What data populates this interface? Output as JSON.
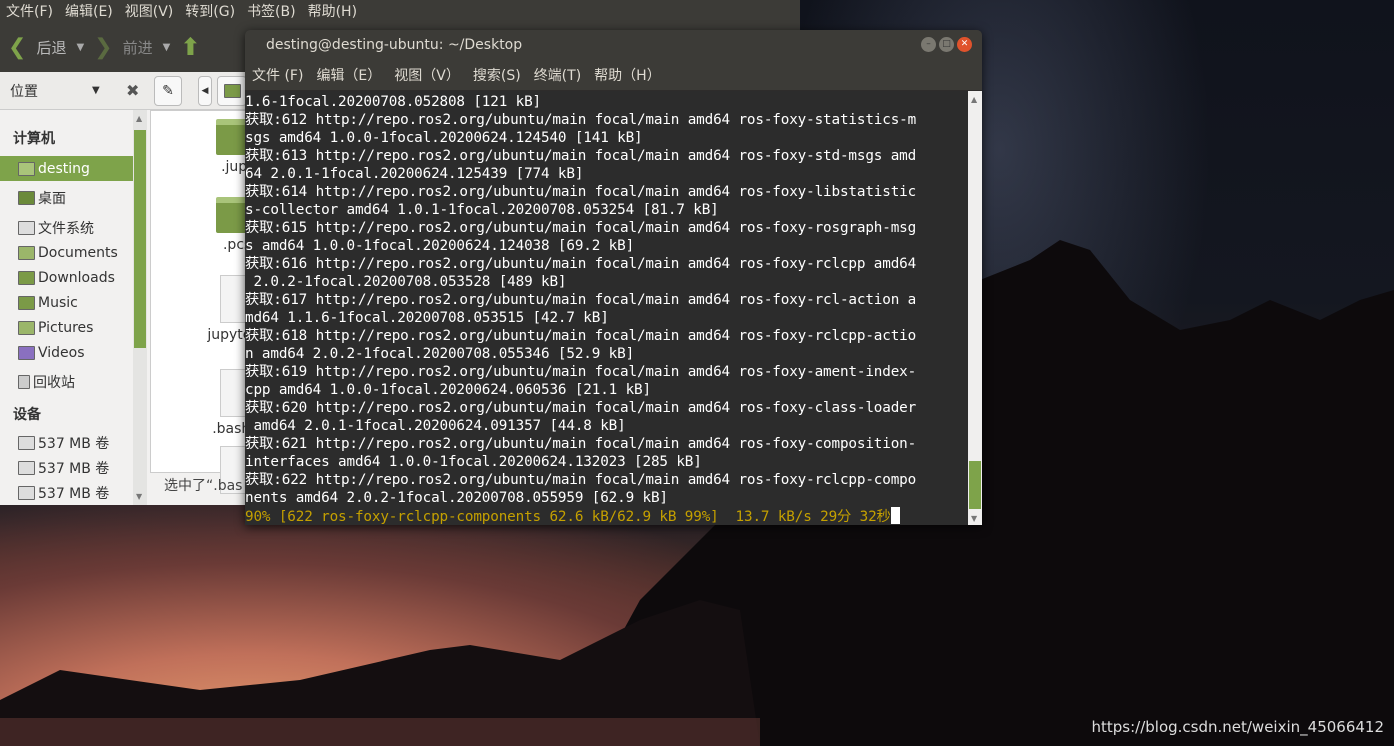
{
  "file_manager": {
    "menu": [
      "文件(F)",
      "编辑(E)",
      "视图(V)",
      "转到(G)",
      "书签(B)",
      "帮助(H)"
    ],
    "toolbar": {
      "back": "后退",
      "forward": "前进"
    },
    "location_label": "位置",
    "sidebar": {
      "computer_header": "计算机",
      "items": [
        {
          "label": "desting",
          "icon": "home-folder-icon",
          "selected": true
        },
        {
          "label": "桌面",
          "icon": "desktop-icon"
        },
        {
          "label": "文件系统",
          "icon": "drive-icon"
        },
        {
          "label": "Documents",
          "icon": "documents-folder-icon"
        },
        {
          "label": "Downloads",
          "icon": "downloads-folder-icon"
        },
        {
          "label": "Music",
          "icon": "music-folder-icon"
        },
        {
          "label": "Pictures",
          "icon": "pictures-folder-icon"
        },
        {
          "label": "Videos",
          "icon": "videos-folder-icon"
        },
        {
          "label": "回收站",
          "icon": "trash-icon"
        }
      ],
      "devices_header": "设备",
      "devices": [
        "537 MB 卷",
        "537 MB 卷",
        "537 MB 卷"
      ]
    },
    "files": [
      ".jupyt",
      ".pcsc",
      "jupyterbo",
      ".bash_lo"
    ],
    "status": "选中了“.bas"
  },
  "terminal": {
    "title": "desting@desting-ubuntu: ~/Desktop",
    "menu": [
      "文件 (F)",
      "编辑（E）",
      "视图（V）",
      "搜索(S)",
      "终端(T)",
      "帮助（H）"
    ],
    "lines": [
      "1.6-1focal.20200708.052808 [121 kB]",
      "获取:612 http://repo.ros2.org/ubuntu/main focal/main amd64 ros-foxy-statistics-m",
      "sgs amd64 1.0.0-1focal.20200624.124540 [141 kB]",
      "获取:613 http://repo.ros2.org/ubuntu/main focal/main amd64 ros-foxy-std-msgs amd",
      "64 2.0.1-1focal.20200624.125439 [774 kB]",
      "获取:614 http://repo.ros2.org/ubuntu/main focal/main amd64 ros-foxy-libstatistic",
      "s-collector amd64 1.0.1-1focal.20200708.053254 [81.7 kB]",
      "获取:615 http://repo.ros2.org/ubuntu/main focal/main amd64 ros-foxy-rosgraph-msg",
      "s amd64 1.0.0-1focal.20200624.124038 [69.2 kB]",
      "获取:616 http://repo.ros2.org/ubuntu/main focal/main amd64 ros-foxy-rclcpp amd64",
      " 2.0.2-1focal.20200708.053528 [489 kB]",
      "获取:617 http://repo.ros2.org/ubuntu/main focal/main amd64 ros-foxy-rcl-action a",
      "md64 1.1.6-1focal.20200708.053515 [42.7 kB]",
      "获取:618 http://repo.ros2.org/ubuntu/main focal/main amd64 ros-foxy-rclcpp-actio",
      "n amd64 2.0.2-1focal.20200708.055346 [52.9 kB]",
      "获取:619 http://repo.ros2.org/ubuntu/main focal/main amd64 ros-foxy-ament-index-",
      "cpp amd64 1.0.0-1focal.20200624.060536 [21.1 kB]",
      "获取:620 http://repo.ros2.org/ubuntu/main focal/main amd64 ros-foxy-class-loader",
      " amd64 2.0.1-1focal.20200624.091357 [44.8 kB]",
      "获取:621 http://repo.ros2.org/ubuntu/main focal/main amd64 ros-foxy-composition-",
      "interfaces amd64 1.0.0-1focal.20200624.132023 [285 kB]",
      "获取:622 http://repo.ros2.org/ubuntu/main focal/main amd64 ros-foxy-rclcpp-compo",
      "nents amd64 2.0.2-1focal.20200708.055959 [62.9 kB]"
    ],
    "progress_line": "90% [622 ros-foxy-rclcpp-components 62.6 kB/62.9 kB 99%]  13.7 kB/s 29分 32秒",
    "progress_color": "#c4a000"
  },
  "watermark": "https://blog.csdn.net/weixin_45066412"
}
